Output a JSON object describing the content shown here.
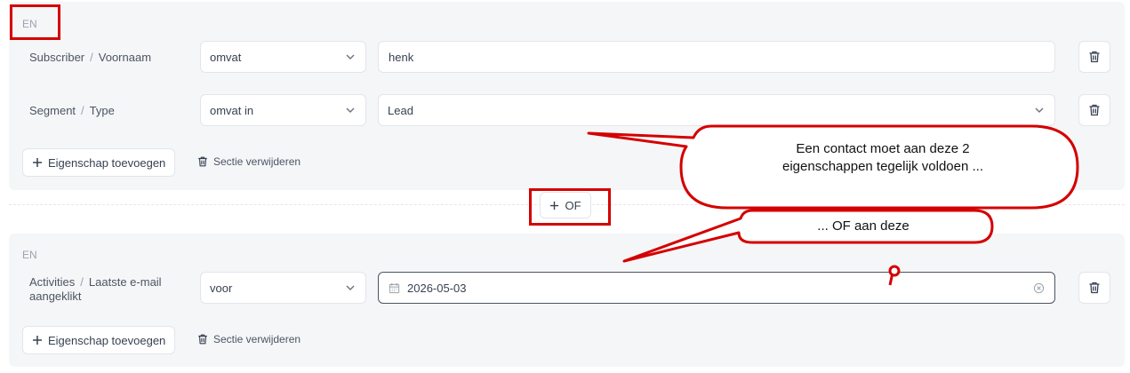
{
  "groups": [
    {
      "connector": "EN",
      "rows": [
        {
          "entity": "Subscriber",
          "field": "Voornaam",
          "operator": "omvat",
          "value": "henk",
          "value_type": "text"
        },
        {
          "entity": "Segment",
          "field": "Type",
          "operator": "omvat in",
          "value": "Lead",
          "value_type": "select"
        }
      ],
      "add_label": "Eigenschap toevoegen",
      "remove_label": "Sectie verwijderen"
    },
    {
      "connector": "EN",
      "rows": [
        {
          "entity": "Activities",
          "field_line1": "Laatste e-mail",
          "field_line2": "aangeklikt",
          "operator": "voor",
          "value": "2026-05-03",
          "value_type": "date"
        }
      ],
      "add_label": "Eigenschap toevoegen",
      "remove_label": "Sectie verwijderen"
    }
  ],
  "or_button": {
    "label": "OF"
  },
  "separator": "/",
  "annotations": {
    "bubble1_line1": "Een contact moet aan deze 2",
    "bubble1_line2": "eigenschappen tegelijk voldoen ...",
    "bubble2": "... OF aan deze",
    "highlight_color": "#d40000"
  },
  "icons": {
    "chevron": "chevron-down-icon",
    "trash": "trash-icon",
    "plus": "plus-icon",
    "calendar": "calendar-icon",
    "clear": "clear-circle-icon"
  }
}
